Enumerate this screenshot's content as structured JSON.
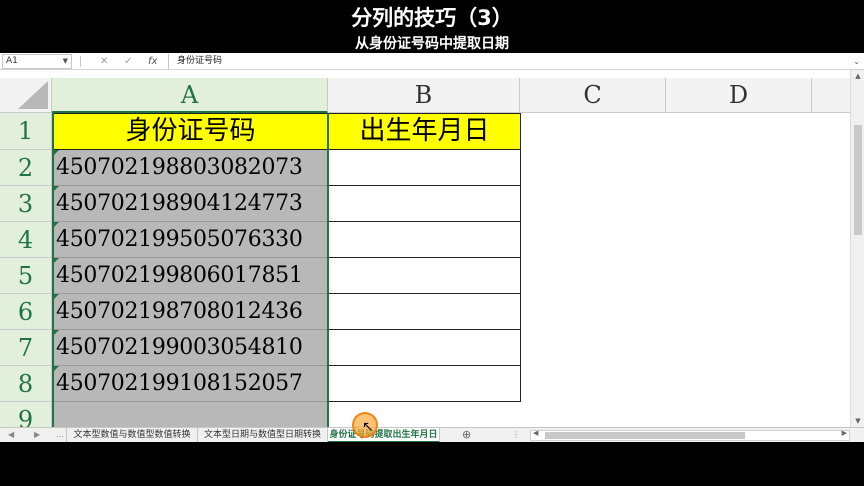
{
  "video": {
    "title": "分列的技巧（3）",
    "subtitle": "从身份证号码中提取日期"
  },
  "formula_bar": {
    "name_box": "A1",
    "cancel_icon": "✕",
    "enter_icon": "✓",
    "fx_icon": "fx",
    "value": "身份证号码"
  },
  "columns": [
    "A",
    "B",
    "C",
    "D"
  ],
  "rows": [
    "1",
    "2",
    "3",
    "4",
    "5",
    "6",
    "7",
    "8",
    "9"
  ],
  "cells": {
    "A1": "身份证号码",
    "B1": "出生年月日",
    "ids": [
      "450702198803082073",
      "450702198904124773",
      "450702199505076330",
      "450702199806017851",
      "450702198708012436",
      "450702199003054810",
      "450702199108152057"
    ]
  },
  "sheet_tabs": [
    {
      "label": "文本型数值与数值型数值转换",
      "active": false
    },
    {
      "label": "文本型日期与数值型日期转换",
      "active": false
    },
    {
      "label": "身份证号码提取出生年月日",
      "active": true
    }
  ],
  "colors": {
    "header_fill": "#ffff00",
    "selection": "#217346",
    "id_cells_fill": "#b8b8b8"
  }
}
